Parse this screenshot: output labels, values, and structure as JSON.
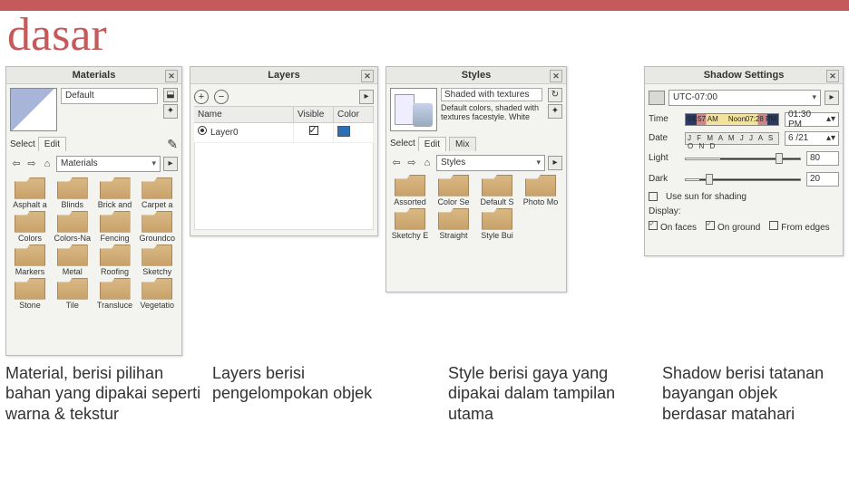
{
  "title": "dasar",
  "materials": {
    "panel_title": "Materials",
    "current": "Default",
    "tabs": {
      "select": "Select",
      "edit": "Edit"
    },
    "dropdown": "Materials",
    "folders": [
      "Asphalt a",
      "Blinds",
      "Brick and",
      "Carpet a",
      "Colors",
      "Colors-Na",
      "Fencing",
      "Groundco",
      "Markers",
      "Metal",
      "Roofing",
      "Sketchy",
      "Stone",
      "Tile",
      "Transluce",
      "Vegetatio"
    ]
  },
  "layers": {
    "panel_title": "Layers",
    "cols": {
      "name": "Name",
      "visible": "Visible",
      "color": "Color"
    },
    "row0": "Layer0"
  },
  "styles": {
    "panel_title": "Styles",
    "name": "Shaded with textures",
    "desc": "Default colors, shaded with textures facestyle. White",
    "tabs": {
      "select": "Select",
      "edit": "Edit",
      "mix": "Mix"
    },
    "dropdown": "Styles",
    "folders": [
      "Assorted",
      "Color Se",
      "Default S",
      "Photo Mo",
      "Sketchy E",
      "Straight",
      "Style Bui"
    ]
  },
  "shadow": {
    "panel_title": "Shadow Settings",
    "tz": "UTC-07:00",
    "time_label": "Time",
    "time_value": "01:30 PM",
    "time_ticks": {
      "a": "04:57 AM",
      "b": "Noon",
      "c": "07:28 PM"
    },
    "date_label": "Date",
    "date_letters": "J F M A M J J A S O N D",
    "date_value": "6 /21",
    "light_label": "Light",
    "light_value": "80",
    "dark_label": "Dark",
    "dark_value": "20",
    "use_sun": "Use sun for shading",
    "display": "Display:",
    "on_faces": "On faces",
    "on_ground": "On ground",
    "from_edges": "From edges"
  },
  "captions": {
    "material": "Material, berisi pilihan bahan yang dipakai seperti warna & tekstur",
    "layers": "Layers berisi pengelompokan objek",
    "style": "Style berisi gaya yang dipakai dalam tampilan utama",
    "shadow": "Shadow berisi tatanan bayangan objek berdasar matahari"
  }
}
